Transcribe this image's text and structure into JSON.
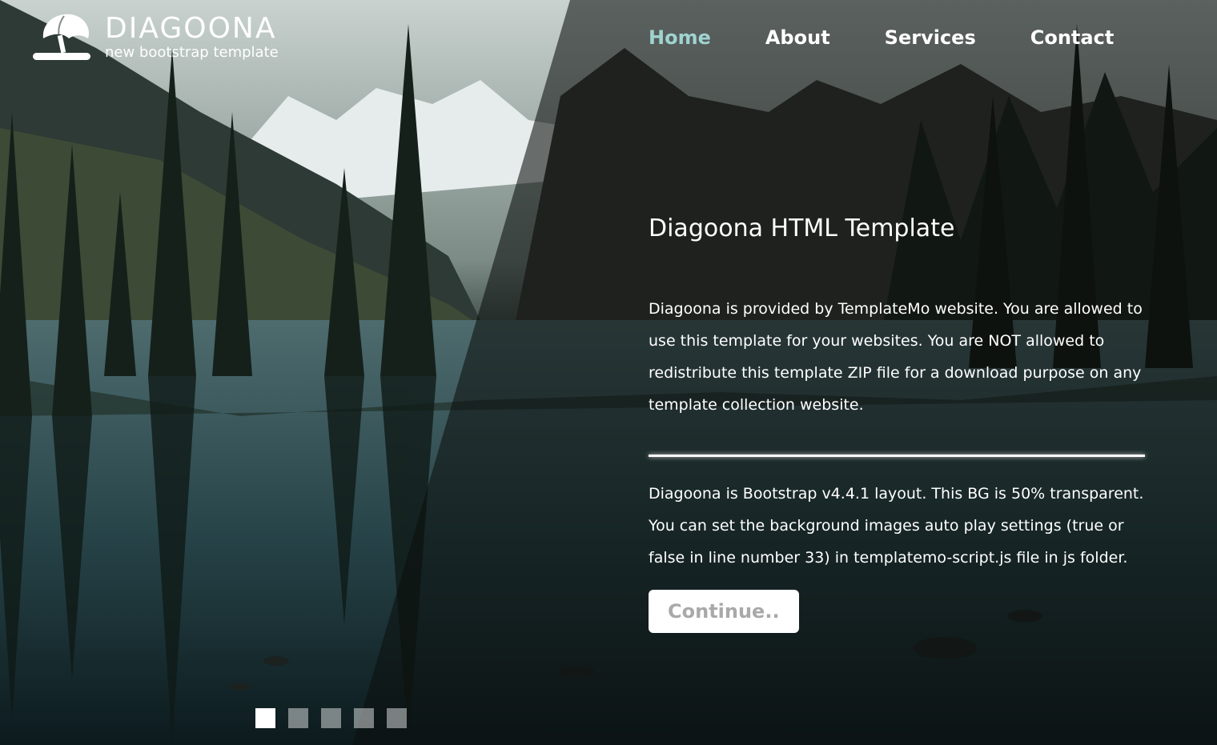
{
  "brand": {
    "title": "DIAGOONA",
    "subtitle": "new bootstrap template"
  },
  "nav": {
    "items": [
      "Home",
      "About",
      "Services",
      "Contact"
    ],
    "active": "Home",
    "active_color": "#9fd3d0"
  },
  "hero": {
    "heading": "Diagoona HTML Template",
    "paragraph1": "Diagoona is provided by TemplateMo website. You are allowed to use this template for your websites. You are NOT allowed to redistribute this template ZIP file for a download purpose on any template collection website.",
    "paragraph2": "Diagoona is Bootstrap v4.4.1 layout. This BG is 50% transparent. You can set the background images auto play settings (true or false in line number 33) in templatemo-script.js file in js folder.",
    "button_label": "Continue.."
  },
  "slider": {
    "count": 5,
    "active_index": 0
  },
  "icons": {
    "logo": "umbrella-icon"
  }
}
